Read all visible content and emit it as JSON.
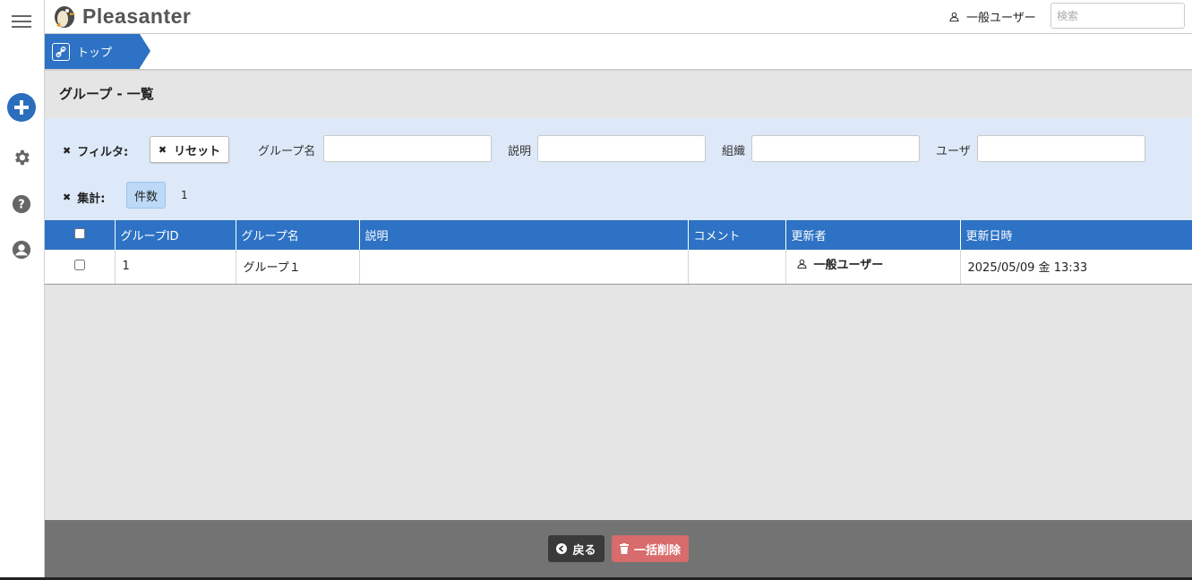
{
  "app": {
    "logo_text": "Pleasanter"
  },
  "header": {
    "user_name": "一般ユーザー",
    "search_placeholder": "検索"
  },
  "breadcrumb": {
    "items": [
      {
        "label": "トップ"
      }
    ]
  },
  "page": {
    "title": "グループ - 一覧"
  },
  "filter": {
    "label": "フィルタ:",
    "reset_label": "リセット",
    "fields": [
      {
        "label": "グループ名",
        "value": ""
      },
      {
        "label": "説明",
        "value": ""
      },
      {
        "label": "組織",
        "value": ""
      },
      {
        "label": "ユーザ",
        "value": ""
      }
    ]
  },
  "aggregate": {
    "label": "集計:",
    "badge": "件数",
    "count": "1"
  },
  "table": {
    "columns": [
      "グループID",
      "グループ名",
      "説明",
      "コメント",
      "更新者",
      "更新日時"
    ],
    "rows": [
      {
        "id": "1",
        "name": "グループ１",
        "description": "",
        "comment": "",
        "updater": "一般ユーザー",
        "updated": "2025/05/09 金 13:33"
      }
    ]
  },
  "footer": {
    "back_label": "戻る",
    "bulk_delete_label": "一括削除"
  },
  "colors": {
    "accent": "#2d72c4",
    "danger": "#d86b6b",
    "filter_bg": "#dde9f8",
    "footer_bg": "#737373"
  },
  "icons": [
    "menu-icon",
    "add-icon",
    "gear-icon",
    "help-icon",
    "account-icon",
    "user-icon",
    "link-icon",
    "back-arrow-icon",
    "trash-icon"
  ]
}
